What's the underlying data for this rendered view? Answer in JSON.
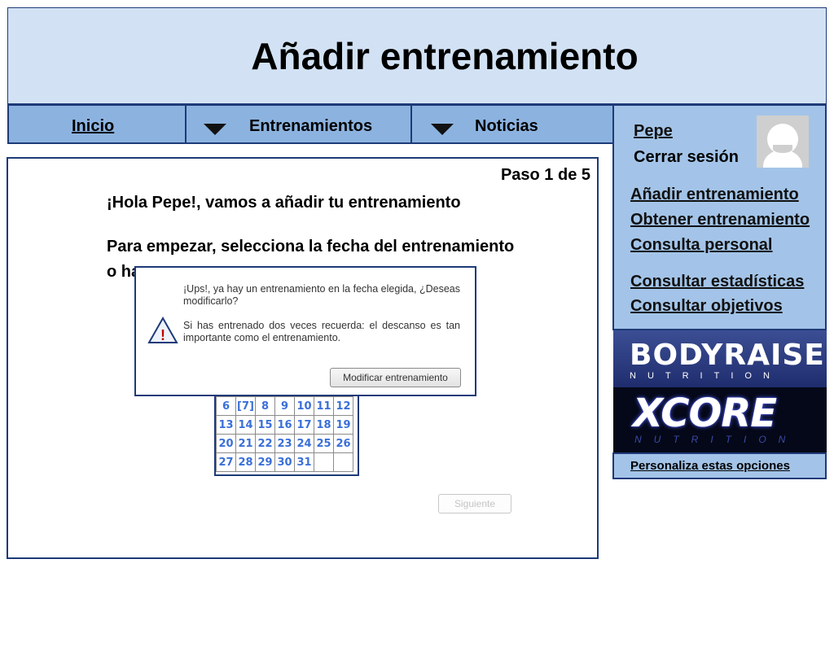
{
  "header": {
    "title": "Añadir entrenamiento"
  },
  "nav": {
    "inicio": "Inicio",
    "entrenamientos": "Entrenamientos",
    "noticias": "Noticias"
  },
  "sidebar": {
    "user_name": "Pepe",
    "logout": "Cerrar sesión",
    "links_group1": [
      "Añadir entrenamiento",
      "Obtener entrenamiento",
      "Consulta personal"
    ],
    "links_group2": [
      "Consultar estadísticas",
      "Consultar objetivos"
    ],
    "banner1_brand": "BODYRAISE",
    "banner1_sub": "NUTRITION",
    "banner2_brand": "XCORE",
    "banner2_sub": "NUTRITION",
    "customize": "Personaliza estas opciones"
  },
  "main": {
    "step": "Paso 1 de 5",
    "greeting": "¡Hola Pepe!, vamos a añadir tu entrenamiento",
    "instruction_line1": "Para empezar, selecciona la fecha del entrenamiento",
    "instruction_line2_visible": "o ha",
    "next_button": "Siguiente"
  },
  "calendar": {
    "rows": [
      [
        "",
        "",
        "",
        "",
        "",
        "",
        ""
      ],
      [
        "6",
        "[7]",
        "8",
        "9",
        "10",
        "11",
        "12"
      ],
      [
        "13",
        "14",
        "15",
        "16",
        "17",
        "18",
        "19"
      ],
      [
        "20",
        "21",
        "22",
        "23",
        "24",
        "25",
        "26"
      ],
      [
        "27",
        "28",
        "29",
        "30",
        "31",
        "",
        ""
      ]
    ]
  },
  "dialog": {
    "message1": "¡Ups!, ya hay un entrenamiento en la fecha elegida, ¿Deseas modificarlo?",
    "message2": "Si has entrenado dos veces recuerda: el descanso es tan importante como el entrenamiento.",
    "button": "Modificar entrenamiento",
    "icon": "warning-icon"
  },
  "colors": {
    "header_bg": "#d2e2f4",
    "nav_bg": "#8cb3e0",
    "sidebar_bg": "#a3c4e8",
    "border": "#1e3a78",
    "calendar_text": "#3a6fd8"
  }
}
